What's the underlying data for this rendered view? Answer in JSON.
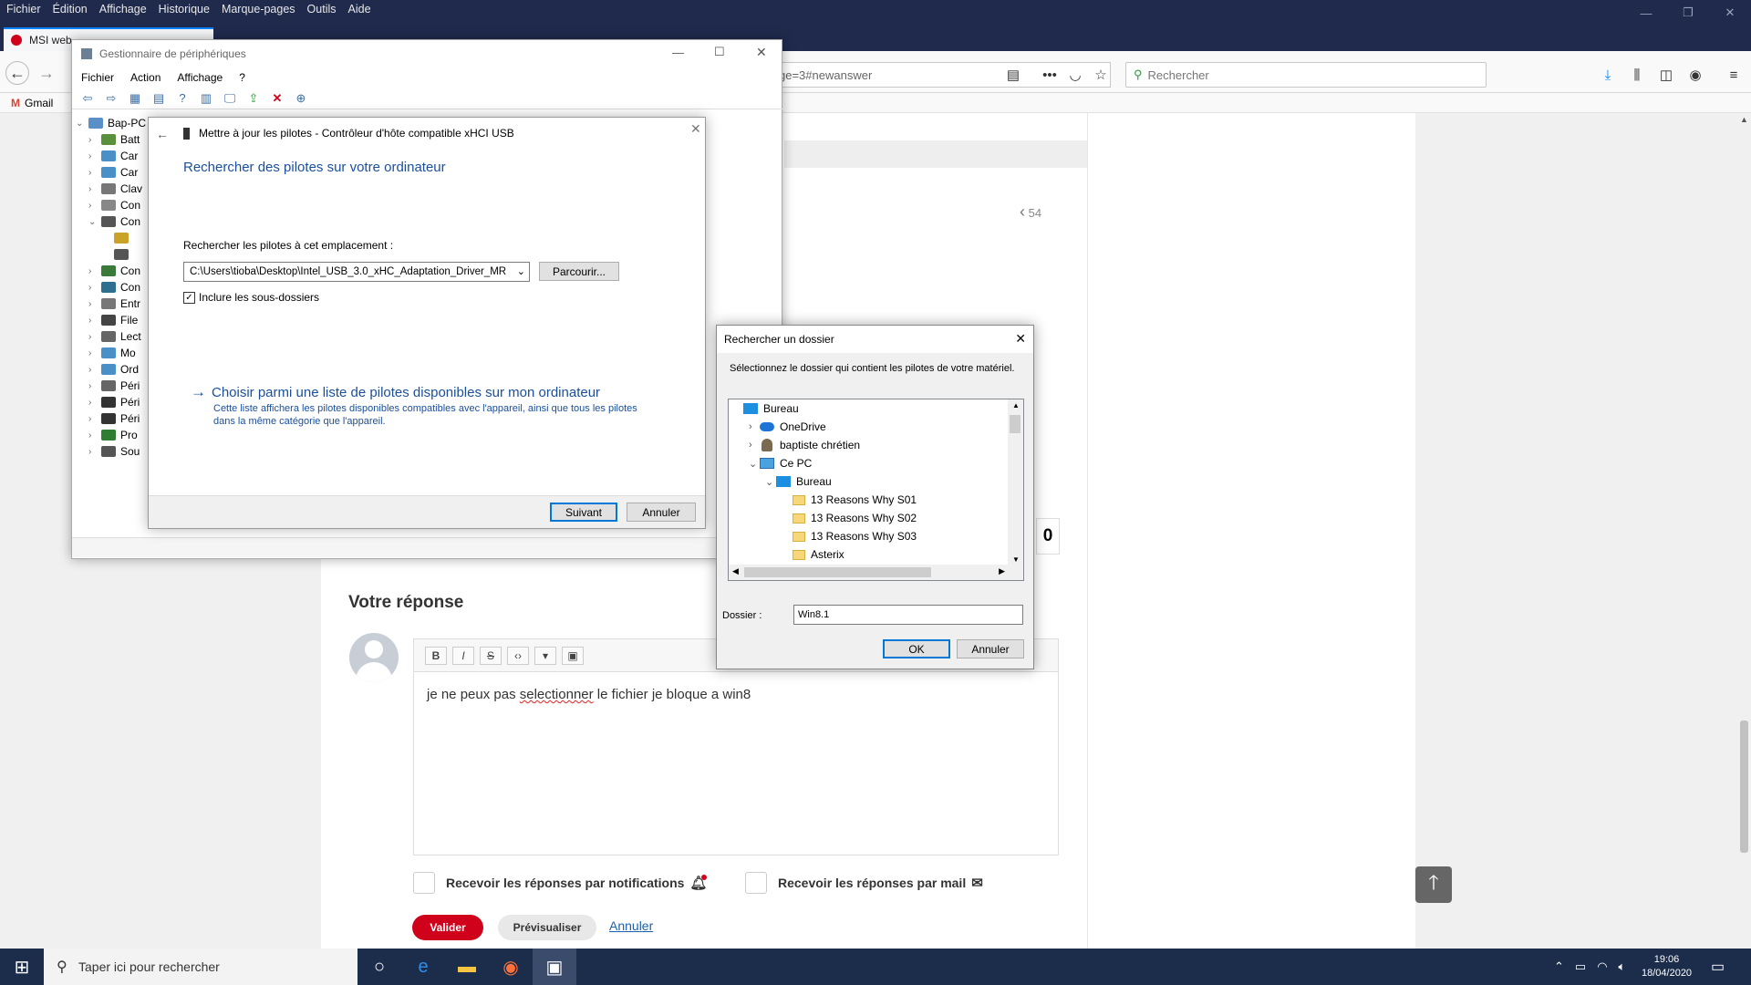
{
  "firefox": {
    "menu": [
      "Fichier",
      "Édition",
      "Affichage",
      "Historique",
      "Marque-pages",
      "Outils",
      "Aide"
    ],
    "tab_title": "MSI web",
    "url_text": "ge=3#newanswer",
    "search_placeholder": "Rechercher",
    "bookmarks": [
      {
        "label": "Gmail"
      }
    ]
  },
  "forum": {
    "prev_count": "54",
    "counter": "0",
    "reply_title": "Votre réponse",
    "toolbar_buttons": [
      "B",
      "I",
      "S",
      "‹›",
      "▾",
      "▣"
    ],
    "reply_text_before": "je ne peux pas ",
    "reply_text_misspelled": "selectionner",
    "reply_text_after": " le fichier je bloque a win8",
    "cb_notifications": "Recevoir les réponses par notifications",
    "cb_mail": "Recevoir les réponses par mail",
    "valider": "Valider",
    "previsualiser": "Prévisualiser",
    "annuler": "Annuler"
  },
  "device_manager": {
    "title": "Gestionnaire de périphériques",
    "menu": [
      "Fichier",
      "Action",
      "Affichage",
      "?"
    ],
    "tree_root": "Bap-PC",
    "tree_items": [
      {
        "label": "Batt",
        "expanded": false
      },
      {
        "label": "Car",
        "expanded": false
      },
      {
        "label": "Car",
        "expanded": false
      },
      {
        "label": "Clav",
        "expanded": false
      },
      {
        "label": "Con",
        "expanded": false
      },
      {
        "label": "Con",
        "expanded": true
      },
      {
        "label": "",
        "expanded": null
      },
      {
        "label": "",
        "expanded": null
      },
      {
        "label": "Con",
        "expanded": false
      },
      {
        "label": "Con",
        "expanded": false
      },
      {
        "label": "Entr",
        "expanded": false
      },
      {
        "label": "File",
        "expanded": false
      },
      {
        "label": "Lect",
        "expanded": false
      },
      {
        "label": "Mo",
        "expanded": false
      },
      {
        "label": "Ord",
        "expanded": false
      },
      {
        "label": "Péri",
        "expanded": false
      },
      {
        "label": "Péri",
        "expanded": false
      },
      {
        "label": "Péri",
        "expanded": false
      },
      {
        "label": "Pro",
        "expanded": false
      },
      {
        "label": "Sou",
        "expanded": false
      }
    ]
  },
  "wizard": {
    "header": "Mettre à jour les pilotes - Contrôleur d'hôte compatible xHCI USB",
    "heading": "Rechercher des pilotes sur votre ordinateur",
    "path_label": "Rechercher les pilotes à cet emplacement :",
    "path_value": "C:\\Users\\tioba\\Desktop\\Intel_USB_3.0_xHC_Adaptation_Driver_MR",
    "browse": "Parcourir...",
    "include_subfolders": "Inclure les sous-dossiers",
    "include_checked": true,
    "choose_link": "Choisir parmi une liste de pilotes disponibles sur mon ordinateur",
    "choose_desc_1": "Cette liste affichera les pilotes disponibles compatibles avec l'appareil, ainsi que tous les pilotes",
    "choose_desc_2": "dans la même catégorie que l'appareil.",
    "next": "Suivant",
    "cancel": "Annuler"
  },
  "browse_dialog": {
    "title": "Rechercher un dossier",
    "instruction": "Sélectionnez le dossier qui contient les pilotes de votre matériel.",
    "tree": [
      {
        "label": "Bureau",
        "level": 0,
        "icon": "blue-folder",
        "chevron": ""
      },
      {
        "label": "OneDrive",
        "level": 1,
        "icon": "cloud",
        "chevron": "›"
      },
      {
        "label": "baptiste chrétien",
        "level": 1,
        "icon": "person",
        "chevron": "›"
      },
      {
        "label": "Ce PC",
        "level": 1,
        "icon": "pc",
        "chevron": "⌄"
      },
      {
        "label": "Bureau",
        "level": 2,
        "icon": "blue-folder",
        "chevron": "⌄"
      },
      {
        "label": "13 Reasons Why S01",
        "level": 3,
        "icon": "folder",
        "chevron": ""
      },
      {
        "label": "13 Reasons Why S02",
        "level": 3,
        "icon": "folder",
        "chevron": ""
      },
      {
        "label": "13 Reasons Why S03",
        "level": 3,
        "icon": "folder",
        "chevron": ""
      },
      {
        "label": "Asterix",
        "level": 3,
        "icon": "folder",
        "chevron": ""
      }
    ],
    "folder_label": "Dossier :",
    "folder_value": "Win8.1",
    "ok": "OK",
    "cancel": "Annuler"
  },
  "taskbar": {
    "search_placeholder": "Taper ici pour rechercher",
    "time": "19:06",
    "date": "18/04/2020"
  }
}
